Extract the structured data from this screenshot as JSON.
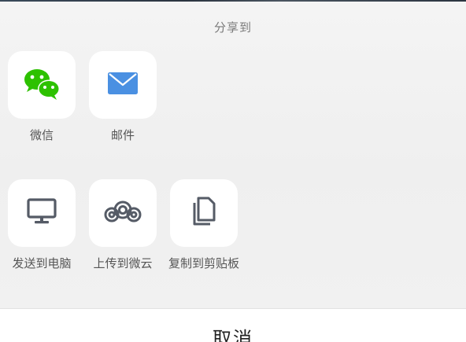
{
  "share_sheet": {
    "title": "分享到",
    "row1": [
      {
        "label": "微信",
        "icon": "wechat-icon",
        "color": "#2dc100"
      },
      {
        "label": "邮件",
        "icon": "mail-icon",
        "color": "#4a90e2"
      }
    ],
    "row2": [
      {
        "label": "发送到电脑",
        "icon": "monitor-icon",
        "color": "#555b66"
      },
      {
        "label": "上传到微云",
        "icon": "weiyun-cloud-icon",
        "color": "#555b66"
      },
      {
        "label": "复制到剪贴板",
        "icon": "copy-icon",
        "color": "#555b66"
      }
    ]
  },
  "cancel": {
    "label": "取消"
  }
}
